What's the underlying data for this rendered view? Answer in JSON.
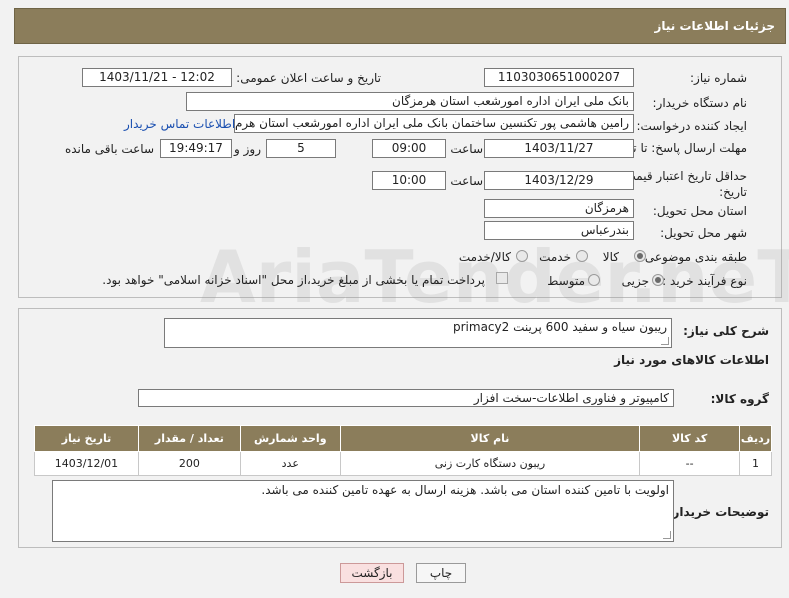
{
  "header": {
    "title": "جزئیات اطلاعات نیاز"
  },
  "form": {
    "need_number": {
      "label": "شماره نیاز:",
      "value": "1103030651000207"
    },
    "announce_datetime": {
      "label": "تاریخ و ساعت اعلان عمومی:",
      "value": "1403/11/21 - 12:02"
    },
    "buyer_org": {
      "label": "نام دستگاه خریدار:",
      "value": "بانک ملی ایران اداره امورشعب استان هرمزگان"
    },
    "requester": {
      "label": "ایجاد کننده درخواست:",
      "value": "رامین هاشمی پور تکنسین ساختمان بانک ملی ایران اداره امورشعب استان هرم",
      "contact_link": "اطلاعات تماس خریدار"
    },
    "reply_deadline": {
      "label": "مهلت ارسال پاسخ: تا تاریخ:",
      "date": "1403/11/27",
      "time_label": "ساعت",
      "time": "09:00",
      "days": "5",
      "days_label": "روز و",
      "remaining": "19:49:17",
      "remaining_label": "ساعت باقی مانده"
    },
    "price_validity": {
      "label": "حداقل تاریخ اعتبار قیمت: تا تاریخ:",
      "date": "1403/12/29",
      "time_label": "ساعت",
      "time": "10:00"
    },
    "delivery_province": {
      "label": "استان محل تحویل:",
      "value": "هرمزگان"
    },
    "delivery_city": {
      "label": "شهر محل تحویل:",
      "value": "بندرعباس"
    },
    "category": {
      "label": "طبقه بندی موضوعی:",
      "options": [
        "کالا",
        "خدمت",
        "کالا/خدمت"
      ],
      "selected": "کالا"
    },
    "purchase_type": {
      "label": "نوع فرآیند خرید :",
      "options": [
        "جزیی",
        "متوسط"
      ],
      "selected": "جزیی",
      "payment_note": "پرداخت تمام یا بخشی از مبلغ خرید،از محل \"اسناد خزانه اسلامی\" خواهد بود."
    }
  },
  "details": {
    "summary_label": "شرح کلی نیاز:",
    "summary_value": "ریبون سیاه و سفید 600 پرینت primacy2",
    "goods_info_title": "اطلاعات کالاهای مورد نیاز",
    "goods_group_label": "گروه کالا:",
    "goods_group_value": "کامپیوتر و فناوری اطلاعات-سخت افزار",
    "table": {
      "headers": [
        "ردیف",
        "کد کالا",
        "نام کالا",
        "واحد شمارش",
        "تعداد / مقدار",
        "تاریخ نیاز"
      ],
      "rows": [
        [
          "1",
          "--",
          "ریبون دستگاه کارت زنی",
          "عدد",
          "200",
          "1403/12/01"
        ]
      ]
    },
    "buyer_notes_label": "توضیحات خریدار:",
    "buyer_notes_value": "اولویت با تامین کننده استان می باشد. هزینه ارسال به عهده تامین کننده می باشد."
  },
  "buttons": {
    "print": "چاپ",
    "back": "بازگشت"
  },
  "watermark": {
    "text": "AriaTender.neT"
  },
  "colors": {
    "header_bg": "#8b7d5b",
    "link": "#1a4fb0",
    "back_btn": "#f9e0e0"
  }
}
